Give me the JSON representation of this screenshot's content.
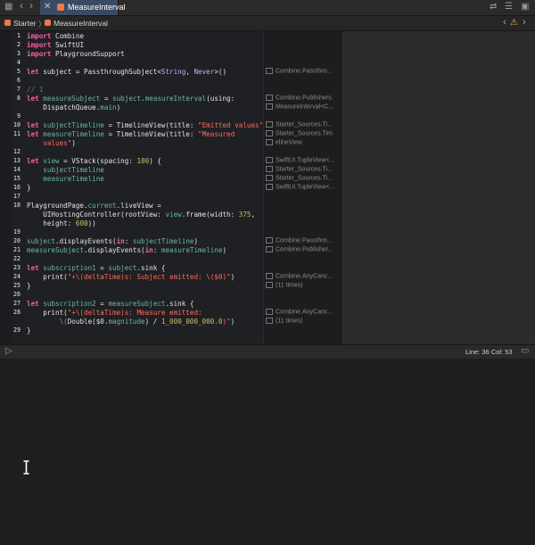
{
  "tabbar": {
    "grid_icon": "▦",
    "back_icon": "‹",
    "forward_icon": "›",
    "close_icon": "✕",
    "tab_label": "MeasureInterval",
    "swap_icon": "⇄",
    "editor_icon": "☰",
    "sidebar_icon": "▣"
  },
  "jumpbar": {
    "crumb1": "Starter",
    "crumb_sep": "〉",
    "crumb2": "MeasureInterval",
    "warning_icon": "⚠",
    "nav_left": "‹",
    "nav_right": "›"
  },
  "lines": [
    {
      "n": "1",
      "html": "<span class=kw>import</span> Combine"
    },
    {
      "n": "2",
      "html": "<span class=kw>import</span> SwiftUI"
    },
    {
      "n": "3",
      "html": "<span class=kw>import</span> PlaygroundSupport"
    },
    {
      "n": "4",
      "html": ""
    },
    {
      "n": "5",
      "html": "<span class=kw>let</span> subject = PassthroughSubject&lt;<span class=ty>String</span>, <span class=ty>Never</span>&gt;()"
    },
    {
      "n": "6",
      "html": ""
    },
    {
      "n": "7",
      "html": "<span class=cm>// 1</span>"
    },
    {
      "n": "8",
      "html": "<span class=kw>let</span> <span class=fn>measureSubject</span> = <span class=fn>subject</span>.<span class=fn>measureInterval</span>(using:"
    },
    {
      "n": "",
      "html": "    DispatchQueue.<span class=fn>main</span>)"
    },
    {
      "n": "9",
      "html": ""
    },
    {
      "n": "10",
      "html": "<span class=kw>let</span> <span class=fn>subjectTimeline</span> = TimelineView(title: <span class=str>\"Emitted values\"</span>)"
    },
    {
      "n": "11",
      "html": "<span class=kw>let</span> <span class=fn>measureTimeline</span> = TimelineView(title: <span class=str>\"Measured</span>"
    },
    {
      "n": "",
      "html": "    <span class=str>values\"</span>)"
    },
    {
      "n": "12",
      "html": ""
    },
    {
      "n": "13",
      "html": "<span class=kw>let</span> <span class=fn>view</span> = VStack(spacing: <span class=num>100</span>) {"
    },
    {
      "n": "14",
      "html": "    <span class=fn>subjectTimeline</span>"
    },
    {
      "n": "15",
      "html": "    <span class=fn>measureTimeline</span>"
    },
    {
      "n": "16",
      "html": "}"
    },
    {
      "n": "17",
      "html": ""
    },
    {
      "n": "18",
      "html": "PlaygroundPage.<span class=fn>current</span>.liveView ="
    },
    {
      "n": "",
      "html": "    UIHostingController(rootView: <span class=fn>view</span>.frame(width: <span class=num>375</span>,"
    },
    {
      "n": "",
      "html": "    height: <span class=num>600</span>))"
    },
    {
      "n": "19",
      "html": ""
    },
    {
      "n": "20",
      "html": "<span class=fn>subject</span>.displayEvents(<span class=kw>in</span>: <span class=fn>subjectTimeline</span>)"
    },
    {
      "n": "21",
      "html": "<span class=fn>measureSubject</span>.displayEvents(<span class=kw>in</span>: <span class=fn>measureTimeline</span>)"
    },
    {
      "n": "22",
      "html": ""
    },
    {
      "n": "23",
      "html": "<span class=kw>let</span> <span class=fn>subscription1</span> = <span class=fn>subject</span>.sink {"
    },
    {
      "n": "24",
      "html": "    print(<span class=str>\"+\\(deltaTime)s: Subject emitted: \\($0)\"</span>)"
    },
    {
      "n": "25",
      "html": "}"
    },
    {
      "n": "26",
      "html": ""
    },
    {
      "n": "27",
      "html": "<span class=kw>let</span> <span class=fn>subscription2</span> = <span class=fn>measureSubject</span>.sink {"
    },
    {
      "n": "28",
      "html": "    print(<span class=str>\"+\\(deltaTime)s: Measure emitted:</span>"
    },
    {
      "n": "",
      "html": "        <span class=str>\\(</span>Double($0.<span class=fn>magnitude</span>) / <span class=num>1_000_000_000.0</span><span class=str>)\"</span>)"
    },
    {
      "n": "29",
      "html": "}"
    }
  ],
  "results": [
    "Combine.Passthro...",
    "Combine.Publishers.",
    "MeasureInterval<C...",
    "Starter_Sources.Ti...",
    "Starter_Sources.Tim",
    "elineView",
    "SwiftUI.TupleView<...",
    "Starter_Sources.Ti...",
    "Starter_Sources.Ti...",
    "SwiftUI.TupleView<...",
    "Combine.Passthro...",
    "Combine.Publisher...",
    "Combine.AnyCanc...",
    "(11 times)",
    "Combine.AnyCanc...",
    "(11 times)"
  ],
  "statusbar": {
    "run_icon": "▷",
    "position": "Line: 36  Col: 53",
    "console_icon": "▭"
  },
  "console": {
    "cursor_icon": "I-beam"
  }
}
